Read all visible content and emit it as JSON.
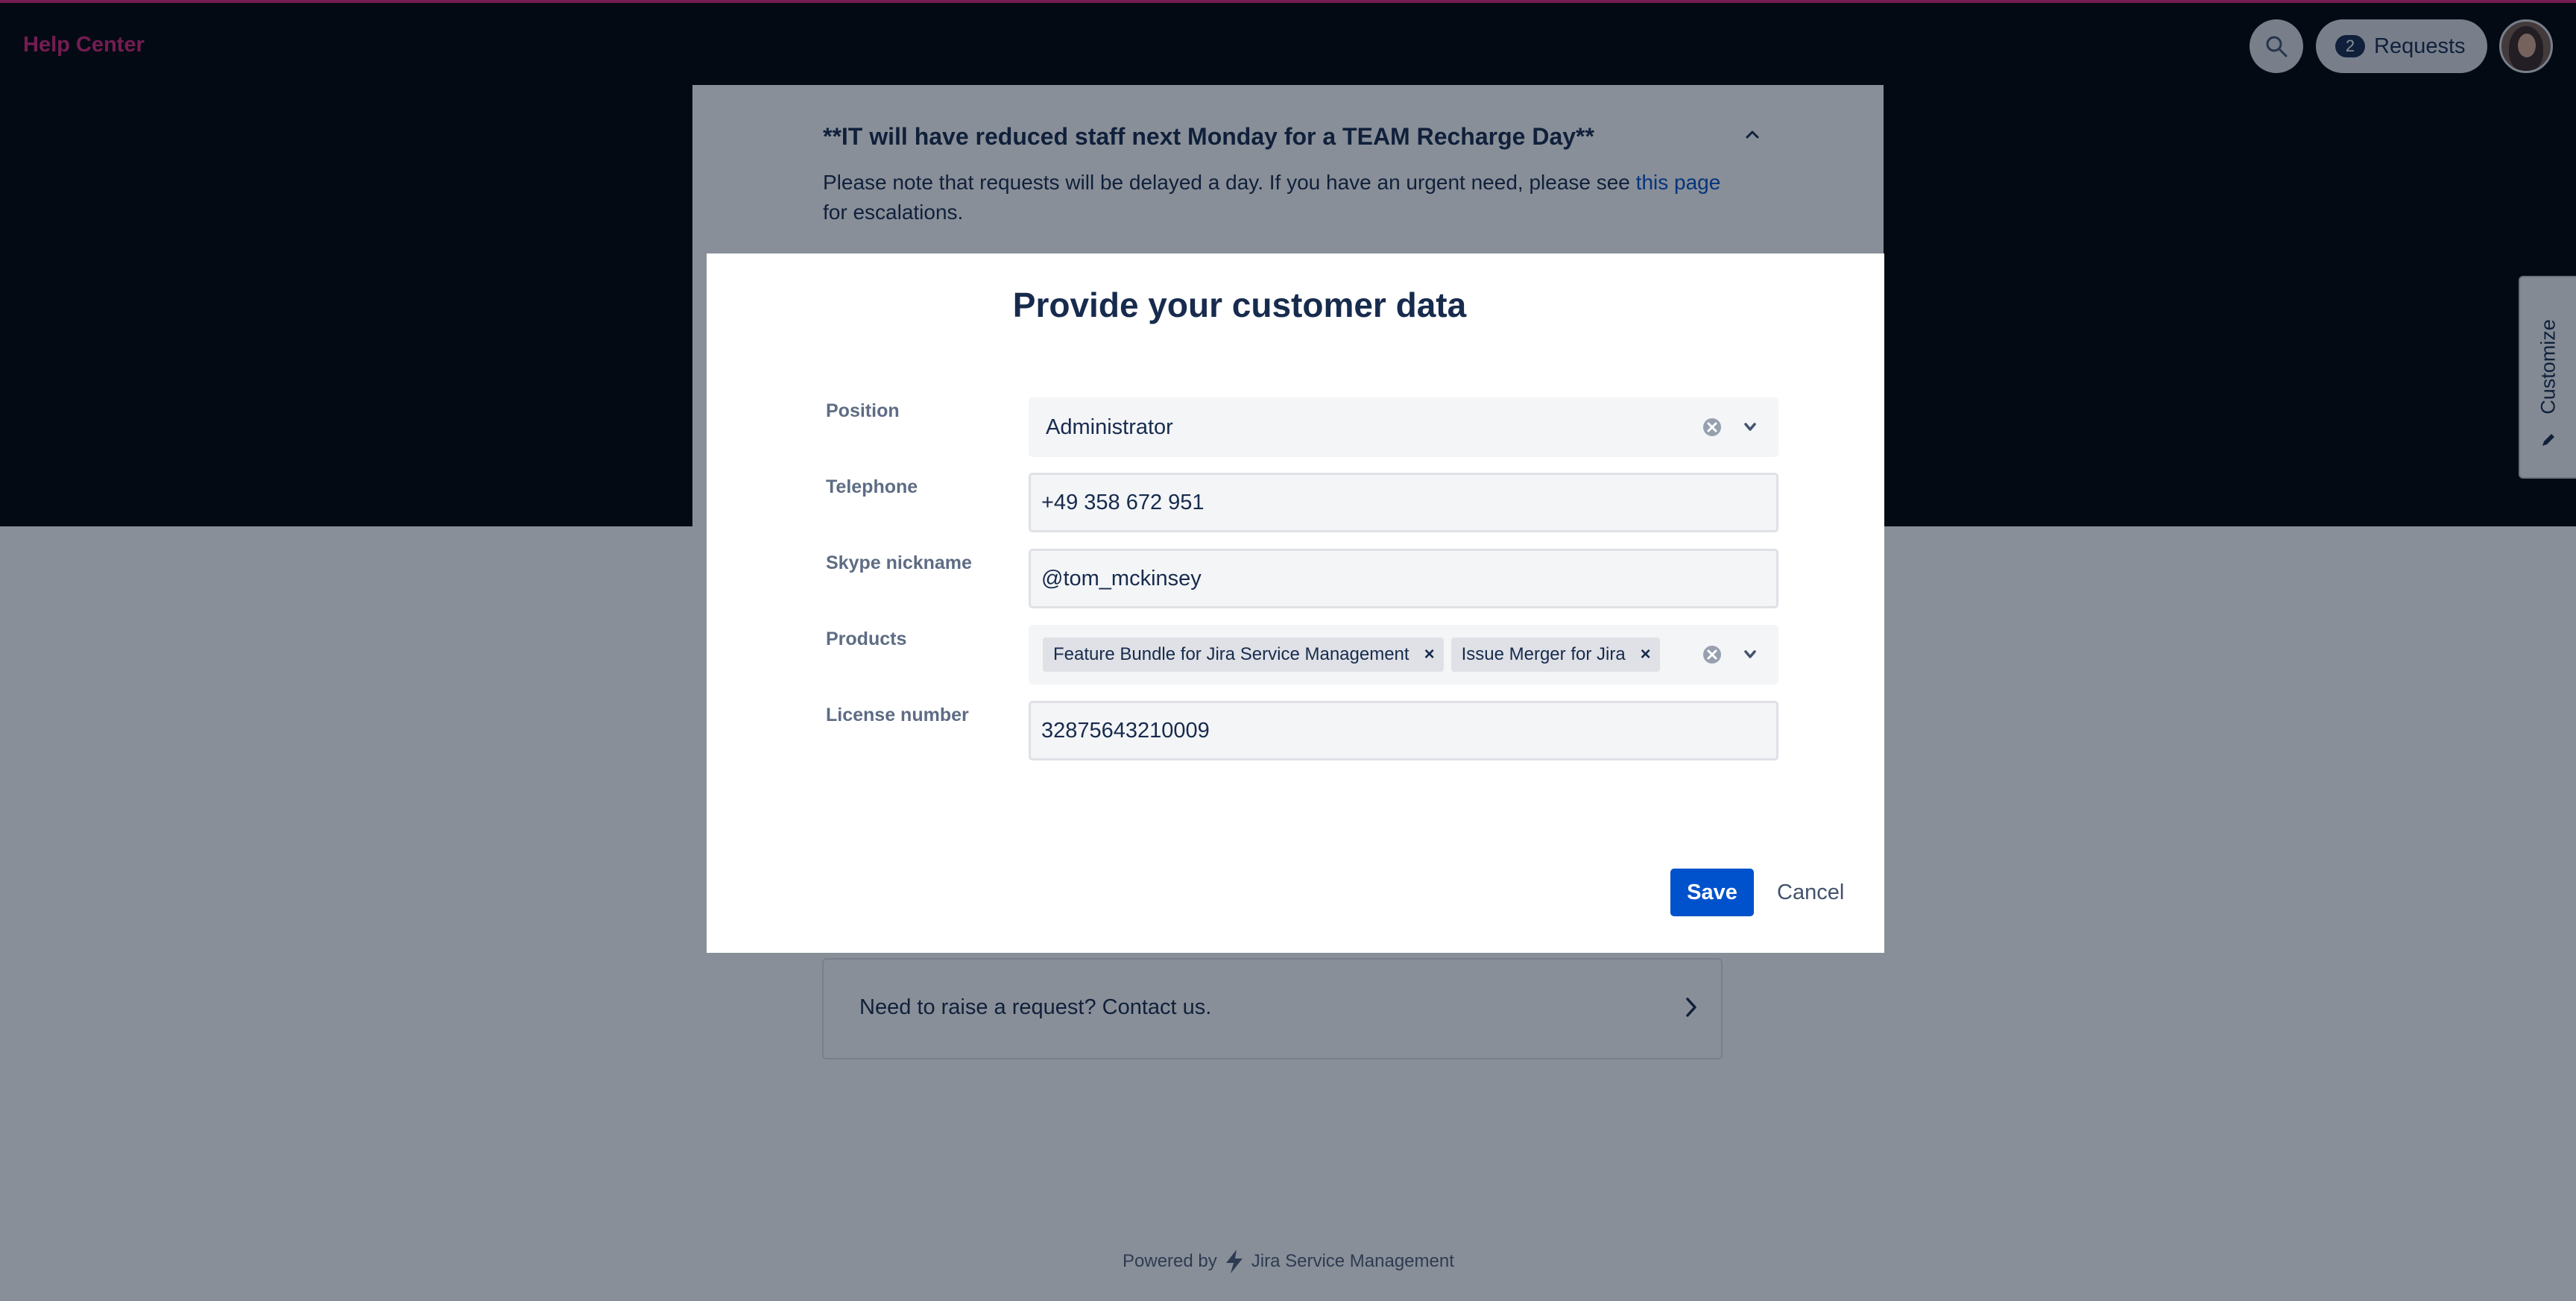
{
  "header": {
    "brand": "Help Center",
    "requests_count": "2",
    "requests_label": "Requests"
  },
  "announcement": {
    "title": "**IT will have reduced staff next Monday for a TEAM Recharge Day**",
    "text_before_link": "Please note that requests will be delayed a day. If you have an urgent need, please see ",
    "link_text": "this page",
    "text_after_link": " for escalations."
  },
  "contact_card": {
    "label": "Need to raise a request? Contact us."
  },
  "footer": {
    "powered_by": "Powered by",
    "product": "Jira Service Management"
  },
  "customize_tab": {
    "label": "Customize"
  },
  "modal": {
    "title": "Provide your customer data",
    "fields": {
      "position": {
        "label": "Position",
        "value": "Administrator"
      },
      "telephone": {
        "label": "Telephone",
        "value": "+49 358 672 951"
      },
      "skype": {
        "label": "Skype nickname",
        "value": "@tom_mckinsey"
      },
      "products": {
        "label": "Products",
        "chips": [
          "Feature Bundle for Jira Service Management",
          "Issue Merger for Jira"
        ]
      },
      "license": {
        "label": "License number",
        "value": "32875643210009"
      }
    },
    "save_label": "Save",
    "cancel_label": "Cancel"
  },
  "colors": {
    "brand": "#d6247c",
    "primary_button": "#0052cc",
    "text": "#172b4d"
  }
}
